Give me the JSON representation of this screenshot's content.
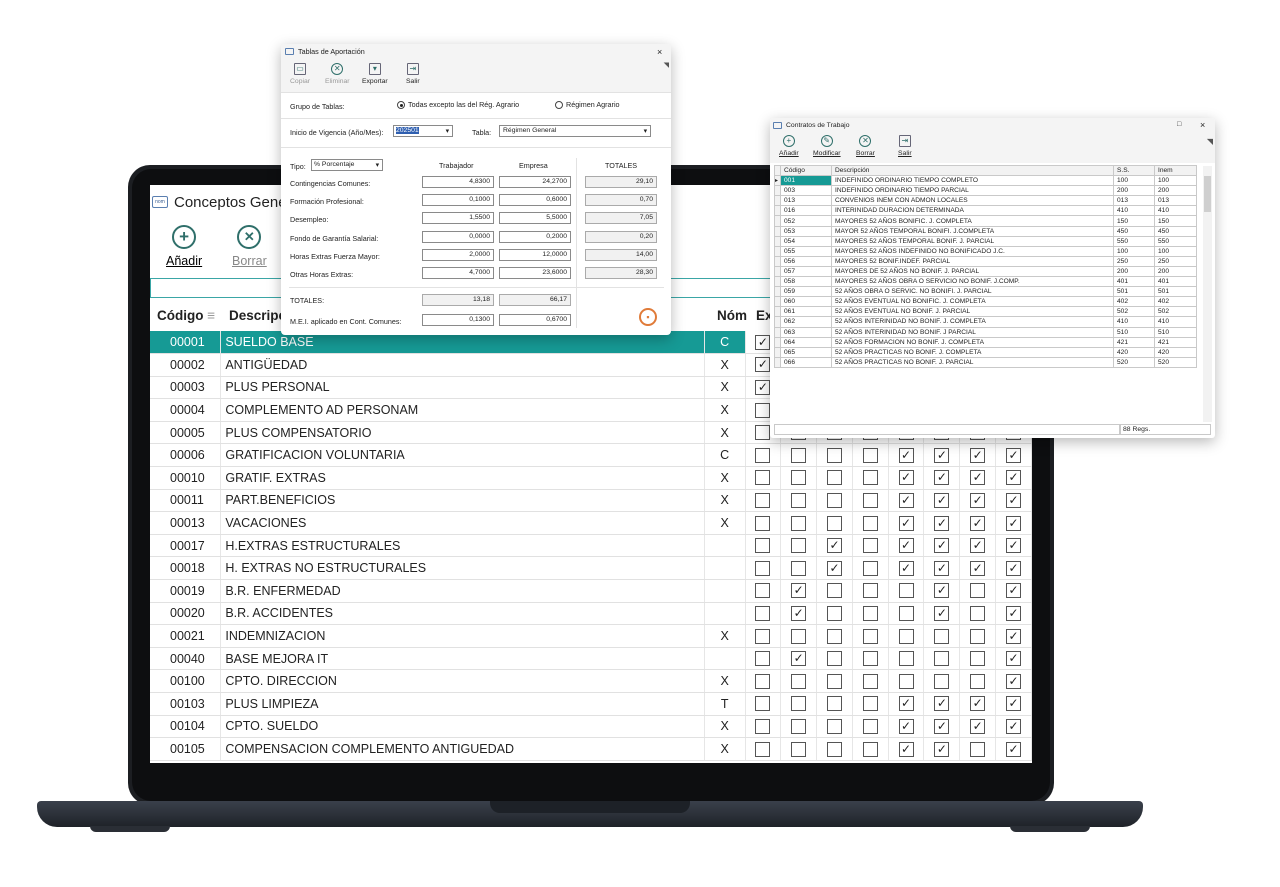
{
  "main": {
    "title": "Conceptos Genera",
    "toolbar": {
      "add": "Añadir",
      "delete": "Borrar"
    },
    "columns": {
      "code": "Código",
      "desc": "Descripci",
      "nom": "Nóm",
      "ex": "Ex"
    },
    "rows": [
      {
        "code": "00001",
        "desc": "SUELDO BASE",
        "nom": "C",
        "checks": [
          1,
          0,
          0,
          0,
          0,
          0,
          0,
          0
        ],
        "selected": true
      },
      {
        "code": "00002",
        "desc": "ANTIGÜEDAD",
        "nom": "X",
        "checks": [
          1,
          0,
          0,
          0,
          0,
          0,
          0,
          0
        ]
      },
      {
        "code": "00003",
        "desc": "PLUS PERSONAL",
        "nom": "X",
        "checks": [
          1,
          0,
          0,
          0,
          0,
          0,
          0,
          0
        ]
      },
      {
        "code": "00004",
        "desc": "COMPLEMENTO AD PERSONAM",
        "nom": "X",
        "checks": [
          0,
          0,
          0,
          0,
          0,
          0,
          0,
          0
        ]
      },
      {
        "code": "00005",
        "desc": "PLUS COMPENSATORIO",
        "nom": "X",
        "checks": [
          0,
          0,
          0,
          0,
          0,
          0,
          0,
          0
        ]
      },
      {
        "code": "00006",
        "desc": "GRATIFICACION VOLUNTARIA",
        "nom": "C",
        "checks": [
          0,
          0,
          0,
          0,
          1,
          1,
          1,
          1
        ]
      },
      {
        "code": "00010",
        "desc": "GRATIF. EXTRAS",
        "nom": "X",
        "checks": [
          0,
          0,
          0,
          0,
          1,
          1,
          1,
          1
        ]
      },
      {
        "code": "00011",
        "desc": "PART.BENEFICIOS",
        "nom": "X",
        "checks": [
          0,
          0,
          0,
          0,
          1,
          1,
          1,
          1
        ]
      },
      {
        "code": "00013",
        "desc": "VACACIONES",
        "nom": "X",
        "checks": [
          0,
          0,
          0,
          0,
          1,
          1,
          1,
          1
        ]
      },
      {
        "code": "00017",
        "desc": "H.EXTRAS ESTRUCTURALES",
        "nom": "",
        "checks": [
          0,
          0,
          1,
          0,
          1,
          1,
          1,
          1
        ]
      },
      {
        "code": "00018",
        "desc": "H. EXTRAS NO ESTRUCTURALES",
        "nom": "",
        "checks": [
          0,
          0,
          1,
          0,
          1,
          1,
          1,
          1
        ]
      },
      {
        "code": "00019",
        "desc": "B.R. ENFERMEDAD",
        "nom": "",
        "checks": [
          0,
          1,
          0,
          0,
          0,
          1,
          0,
          1
        ]
      },
      {
        "code": "00020",
        "desc": "B.R. ACCIDENTES",
        "nom": "",
        "checks": [
          0,
          1,
          0,
          0,
          0,
          1,
          0,
          1
        ]
      },
      {
        "code": "00021",
        "desc": "INDEMNIZACION",
        "nom": "X",
        "checks": [
          0,
          0,
          0,
          0,
          0,
          0,
          0,
          1
        ]
      },
      {
        "code": "00040",
        "desc": "BASE MEJORA IT",
        "nom": "",
        "checks": [
          0,
          1,
          0,
          0,
          0,
          0,
          0,
          1
        ]
      },
      {
        "code": "00100",
        "desc": "CPTO. DIRECCION",
        "nom": "X",
        "checks": [
          0,
          0,
          0,
          0,
          0,
          0,
          0,
          1
        ]
      },
      {
        "code": "00103",
        "desc": "PLUS LIMPIEZA",
        "nom": "T",
        "checks": [
          0,
          0,
          0,
          0,
          1,
          1,
          1,
          1
        ]
      },
      {
        "code": "00104",
        "desc": "CPTO. SUELDO",
        "nom": "X",
        "checks": [
          0,
          0,
          0,
          0,
          1,
          1,
          1,
          1
        ]
      },
      {
        "code": "00105",
        "desc": "COMPENSACION COMPLEMENTO ANTIGUEDAD",
        "nom": "X",
        "checks": [
          0,
          0,
          0,
          0,
          1,
          1,
          0,
          1
        ]
      }
    ]
  },
  "aportacion": {
    "title": "Tablas de Aportación",
    "close": "×",
    "toolbar": {
      "copy": "Copiar",
      "delete": "Eliminar",
      "export": "Exportar",
      "exit": "Salir"
    },
    "group_label": "Grupo de Tablas:",
    "radio1": "Todas excepto las del Rég. Agrario",
    "radio2": "Régimen Agrario",
    "vigencia_label": "Inicio de Vigencia (Año/Mes):",
    "vigencia_value": "202501",
    "tabla_label": "Tabla:",
    "tabla_value": "Régimen General",
    "tipo_label": "Tipo:",
    "tipo_value": "% Porcentaje",
    "headers": {
      "trab": "Trabajador",
      "emp": "Empresa",
      "tot": "TOTALES"
    },
    "rows": [
      {
        "label": "Contingencias Comunes:",
        "trab": "4,8300",
        "emp": "24,2700",
        "tot": "29,10"
      },
      {
        "label": "Formación Profesional:",
        "trab": "0,1000",
        "emp": "0,6000",
        "tot": "0,70"
      },
      {
        "label": "Desempleo:",
        "trab": "1,5500",
        "emp": "5,5000",
        "tot": "7,05"
      },
      {
        "label": "Fondo de Garantía Salarial:",
        "trab": "0,0000",
        "emp": "0,2000",
        "tot": "0,20"
      },
      {
        "label": "Horas Extras Fuerza Mayor:",
        "trab": "2,0000",
        "emp": "12,0000",
        "tot": "14,00"
      },
      {
        "label": "Otras Horas Extras:",
        "trab": "4,7000",
        "emp": "23,6000",
        "tot": "28,30"
      }
    ],
    "totales_label": "TOTALES:",
    "totales_trab": "13,18",
    "totales_emp": "66,17",
    "mei_label": "M.E.I. aplicado en Cont. Comunes:",
    "mei_trab": "0,1300",
    "mei_emp": "0,6700"
  },
  "contratos": {
    "title": "Contratos de Trabajo",
    "toolbar": {
      "add": "Añadir",
      "modify": "Modificar",
      "delete": "Borrar",
      "exit": "Salir"
    },
    "headers": {
      "code": "Código",
      "desc": "Descripción",
      "ss": "S.S.",
      "inem": "Inem"
    },
    "rows": [
      {
        "code": "001",
        "desc": "INDEFINIDO ORDINARIO TIEMPO COMPLETO",
        "ss": "100",
        "inem": "100"
      },
      {
        "code": "003",
        "desc": "INDEFINIDO ORDINARIO TIEMPO PARCIAL",
        "ss": "200",
        "inem": "200"
      },
      {
        "code": "013",
        "desc": "CONVENIOS INEM CON ADMON LOCALES",
        "ss": "013",
        "inem": "013"
      },
      {
        "code": "016",
        "desc": "INTERINIDAD DURACION DETERMINADA",
        "ss": "410",
        "inem": "410"
      },
      {
        "code": "052",
        "desc": "MAYORES 52 AÑOS BONIFIC. J. COMPLETA",
        "ss": "150",
        "inem": "150"
      },
      {
        "code": "053",
        "desc": "MAYOR 52 AÑOS TEMPORAL BONIFI. J.COMPLETA",
        "ss": "450",
        "inem": "450"
      },
      {
        "code": "054",
        "desc": "MAYORES 52 AÑOS TEMPORAL BONIF. J. PARCIAL",
        "ss": "550",
        "inem": "550"
      },
      {
        "code": "055",
        "desc": "MAYORES 52 AÑOS INDEFINIDO NO BONIFICADO J.C.",
        "ss": "100",
        "inem": "100"
      },
      {
        "code": "056",
        "desc": "MAYORES 52 BONIF.INDEF. PARCIAL",
        "ss": "250",
        "inem": "250"
      },
      {
        "code": "057",
        "desc": "MAYORES DE 52 AÑOS NO BONIF. J. PARCIAL",
        "ss": "200",
        "inem": "200"
      },
      {
        "code": "058",
        "desc": "MAYORES 52 AÑOS OBRA O SERVICIO NO BONIF. J.COMP.",
        "ss": "401",
        "inem": "401"
      },
      {
        "code": "059",
        "desc": "52 AÑOS OBRA O SERVIC. NO BONIFI. J. PARCIAL",
        "ss": "501",
        "inem": "501"
      },
      {
        "code": "060",
        "desc": "52 AÑOS EVENTUAL NO BONIFIC. J. COMPLETA",
        "ss": "402",
        "inem": "402"
      },
      {
        "code": "061",
        "desc": "52 AÑOS EVENTUAL NO BONIF. J. PARCIAL",
        "ss": "502",
        "inem": "502"
      },
      {
        "code": "062",
        "desc": "52 AÑOS INTERINIDAD NO BONIF. J. COMPLETA",
        "ss": "410",
        "inem": "410"
      },
      {
        "code": "063",
        "desc": "52 AÑOS INTERINIDAD NO BONIF. J PARCIAL",
        "ss": "510",
        "inem": "510"
      },
      {
        "code": "064",
        "desc": "52 AÑOS FORMACION NO BONIF. J. COMPLETA",
        "ss": "421",
        "inem": "421"
      },
      {
        "code": "065",
        "desc": "52 AÑOS PRACTICAS NO BONIF. J. COMPLETA",
        "ss": "420",
        "inem": "420"
      },
      {
        "code": "066",
        "desc": "52 AÑOS PRACTICAS NO BONIF. J. PARCIAL",
        "ss": "520",
        "inem": "520"
      }
    ],
    "status": "88 Regs."
  }
}
